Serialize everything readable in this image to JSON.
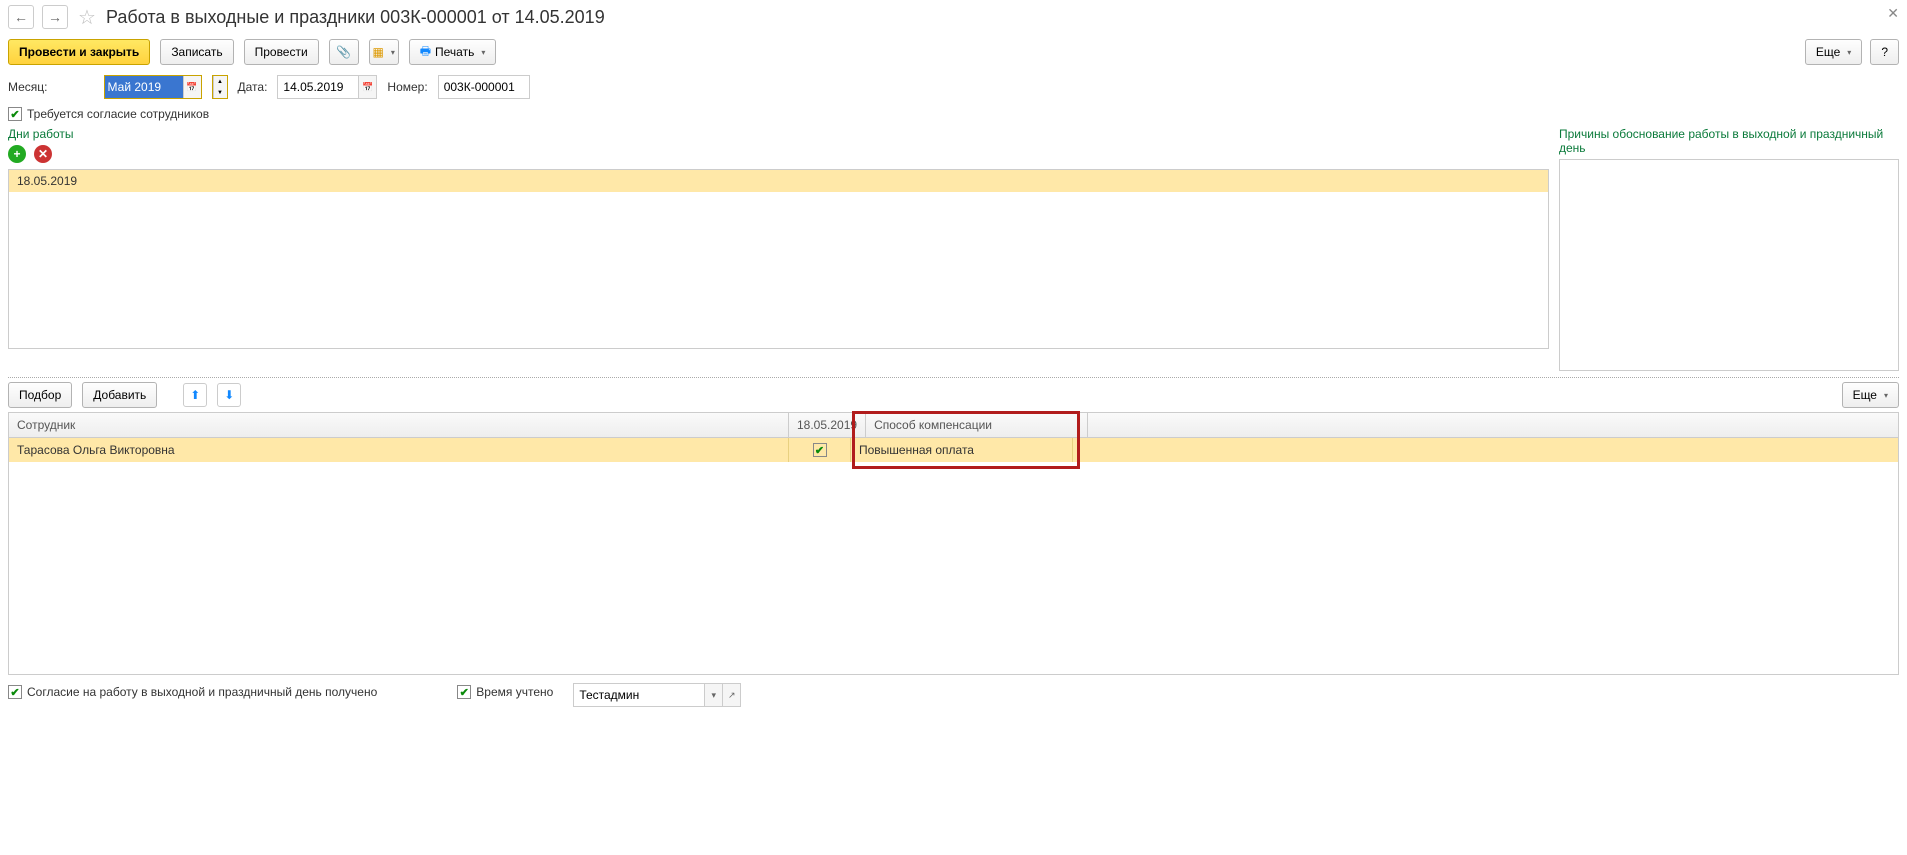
{
  "header": {
    "title": "Работа в выходные и праздники 003К-000001 от 14.05.2019"
  },
  "toolbar": {
    "post_close": "Провести и закрыть",
    "save": "Записать",
    "post": "Провести",
    "print": "Печать",
    "more": "Еще",
    "help": "?"
  },
  "form": {
    "month_label": "Месяц:",
    "month_value": "Май 2019",
    "date_label": "Дата:",
    "date_value": "14.05.2019",
    "number_label": "Номер:",
    "number_value": "003К-000001",
    "consent_label": "Требуется согласие сотрудников"
  },
  "days": {
    "label": "Дни работы",
    "rows": [
      "18.05.2019"
    ]
  },
  "reasons": {
    "label": "Причины обоснование работы в выходной и праздничный день"
  },
  "grid_toolbar": {
    "select": "Подбор",
    "add": "Добавить",
    "more": "Еще"
  },
  "grid": {
    "headers": {
      "employee": "Сотрудник",
      "date": "18.05.2019",
      "compensation": "Способ компенсации"
    },
    "rows": [
      {
        "employee": "Тарасова Ольга Викторовна",
        "checked": true,
        "compensation": "Повышенная оплата"
      }
    ]
  },
  "footer": {
    "consent_received": "Согласие на работу в выходной и праздничный день получено",
    "time_recorded": "Время учтено",
    "user": "Тестадмин"
  }
}
